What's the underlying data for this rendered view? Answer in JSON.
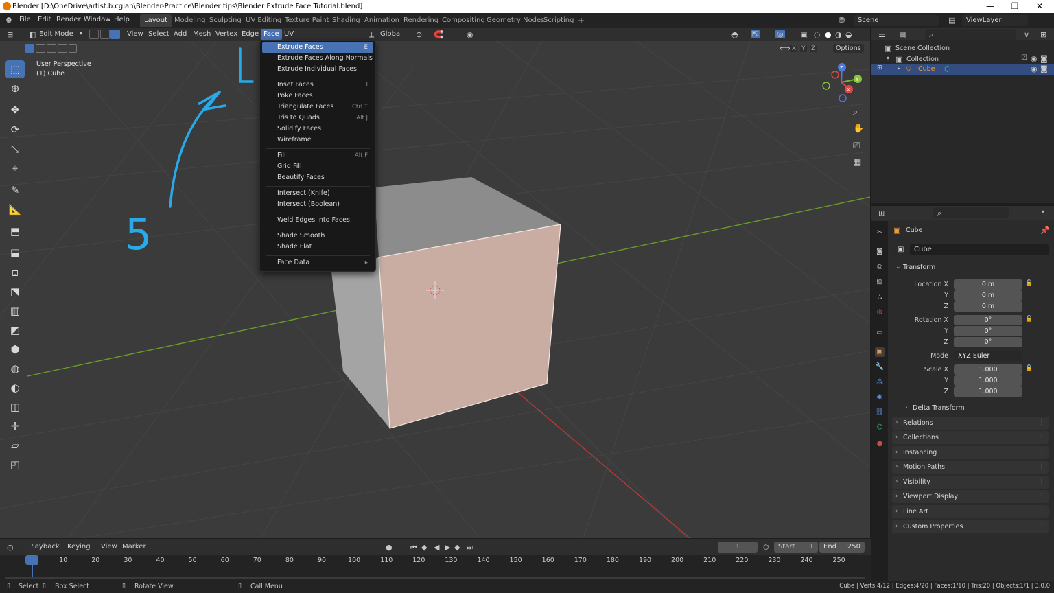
{
  "window": {
    "title": "Blender [D:\\OneDrive\\artist.b.cgian\\Blender-Practice\\Blender tips\\Blender Extrude Face Tutorial.blend]",
    "minimize": "—",
    "restore": "❐",
    "close": "✕"
  },
  "topbar": {
    "menus": [
      "File",
      "Edit",
      "Render",
      "Window",
      "Help"
    ],
    "workspaces": [
      "Layout",
      "Modeling",
      "Sculpting",
      "UV Editing",
      "Texture Paint",
      "Shading",
      "Animation",
      "Rendering",
      "Compositing",
      "Geometry Nodes",
      "Scripting"
    ],
    "active_workspace": "Layout",
    "add_tab": "+",
    "scene": "Scene",
    "view_layer": "ViewLayer"
  },
  "viewport_header": {
    "mode": "Edit Mode",
    "menus": [
      "View",
      "Select",
      "Add",
      "Mesh",
      "Vertex",
      "Edge",
      "Face",
      "UV"
    ],
    "active_menu": "Face",
    "orientation": "Global",
    "axes": [
      "X",
      "Y",
      "Z"
    ],
    "options": "Options"
  },
  "viewport": {
    "perspective": "User Perspective",
    "object": "(1) Cube",
    "annotation_text": "5",
    "gizmo": {
      "x": "X",
      "y": "Y",
      "z": "Z"
    }
  },
  "face_menu": {
    "groups": [
      [
        {
          "label": "Extrude Faces",
          "shortcut": "E",
          "highlight": true
        },
        {
          "label": "Extrude Faces Along Normals",
          "shortcut": ""
        },
        {
          "label": "Extrude Individual Faces",
          "shortcut": ""
        }
      ],
      [
        {
          "label": "Inset Faces",
          "shortcut": "I"
        },
        {
          "label": "Poke Faces",
          "shortcut": ""
        },
        {
          "label": "Triangulate Faces",
          "shortcut": "Ctrl T"
        },
        {
          "label": "Tris to Quads",
          "shortcut": "Alt J"
        },
        {
          "label": "Solidify Faces",
          "shortcut": ""
        },
        {
          "label": "Wireframe",
          "shortcut": ""
        }
      ],
      [
        {
          "label": "Fill",
          "shortcut": "Alt F"
        },
        {
          "label": "Grid Fill",
          "shortcut": ""
        },
        {
          "label": "Beautify Faces",
          "shortcut": ""
        }
      ],
      [
        {
          "label": "Intersect (Knife)",
          "shortcut": ""
        },
        {
          "label": "Intersect (Boolean)",
          "shortcut": ""
        }
      ],
      [
        {
          "label": "Weld Edges into Faces",
          "shortcut": ""
        }
      ],
      [
        {
          "label": "Shade Smooth",
          "shortcut": ""
        },
        {
          "label": "Shade Flat",
          "shortcut": ""
        }
      ],
      [
        {
          "label": "Face Data",
          "shortcut": "▸"
        }
      ]
    ]
  },
  "outliner": {
    "scene_collection": "Scene Collection",
    "collection": "Collection",
    "cube": "Cube"
  },
  "properties": {
    "object_name": "Cube",
    "datablock": "Cube",
    "transform_label": "Transform",
    "location": {
      "label_x": "Location X",
      "x": "0 m",
      "y": "0 m",
      "z": "0 m"
    },
    "rotation": {
      "label_x": "Rotation X",
      "x": "0°",
      "y": "0°",
      "z": "0°"
    },
    "mode_label": "Mode",
    "mode": "XYZ Euler",
    "scale": {
      "label_x": "Scale X",
      "x": "1.000",
      "y": "1.000",
      "z": "1.000"
    },
    "axis_y": "Y",
    "axis_z": "Z",
    "delta": "Delta Transform",
    "panels": [
      "Relations",
      "Collections",
      "Instancing",
      "Motion Paths",
      "Visibility",
      "Viewport Display",
      "Line Art",
      "Custom Properties"
    ]
  },
  "timeline": {
    "menus": [
      "Playback",
      "Keying",
      "View",
      "Marker"
    ],
    "current_frame": "1",
    "start_label": "Start",
    "start": "1",
    "end_label": "End",
    "end": "250",
    "ticks": [
      "1",
      "10",
      "20",
      "30",
      "40",
      "50",
      "60",
      "70",
      "80",
      "90",
      "100",
      "110",
      "120",
      "130",
      "140",
      "150",
      "160",
      "170",
      "180",
      "190",
      "200",
      "210",
      "220",
      "230",
      "240",
      "250"
    ]
  },
  "statusbar": {
    "select": "Select",
    "box_select": "Box Select",
    "rotate_view": "Rotate View",
    "call_menu": "Call Menu",
    "stats": "Cube | Verts:4/12 | Edges:4/20 | Faces:1/10 | Tris:20 | Objects:1/1 | 3.0.0"
  },
  "colors": {
    "accent": "#4772b3",
    "annotation": "#2aa9e8",
    "selected_face": "#c9aca2",
    "x_axis": "#b83a3a",
    "y_axis": "#6b9b2a"
  }
}
